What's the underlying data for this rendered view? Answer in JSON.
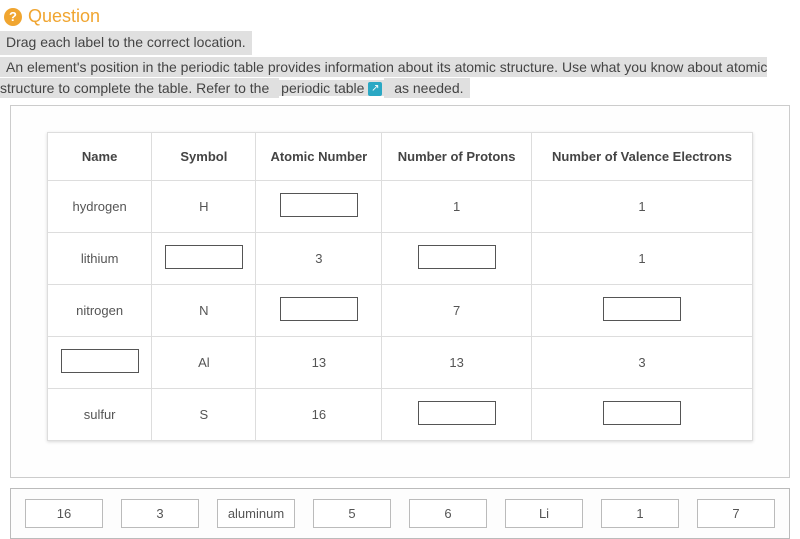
{
  "header": {
    "icon_glyph": "?",
    "title": "Question"
  },
  "instruction_line1": "Drag each label to the correct location.",
  "instruction_line2_pre": "An element's position in the periodic table provides information about its atomic structure. Use what you know about atomic structure to complete the table. Refer to the ",
  "instruction_link_text": "periodic table",
  "instruction_line2_post": " as needed.",
  "table": {
    "headers": [
      "Name",
      "Symbol",
      "Atomic Number",
      "Number of Protons",
      "Number of Valence Electrons"
    ],
    "rows": [
      {
        "name": "hydrogen",
        "symbol": "H",
        "atomic": "",
        "protons": "1",
        "valence": "1"
      },
      {
        "name": "lithium",
        "symbol": "",
        "atomic": "3",
        "protons": "",
        "valence": "1"
      },
      {
        "name": "nitrogen",
        "symbol": "N",
        "atomic": "",
        "protons": "7",
        "valence": ""
      },
      {
        "name": "",
        "symbol": "Al",
        "atomic": "13",
        "protons": "13",
        "valence": "3"
      },
      {
        "name": "sulfur",
        "symbol": "S",
        "atomic": "16",
        "protons": "",
        "valence": ""
      }
    ]
  },
  "labels": [
    "16",
    "3",
    "aluminum",
    "5",
    "6",
    "Li",
    "1",
    "7"
  ]
}
